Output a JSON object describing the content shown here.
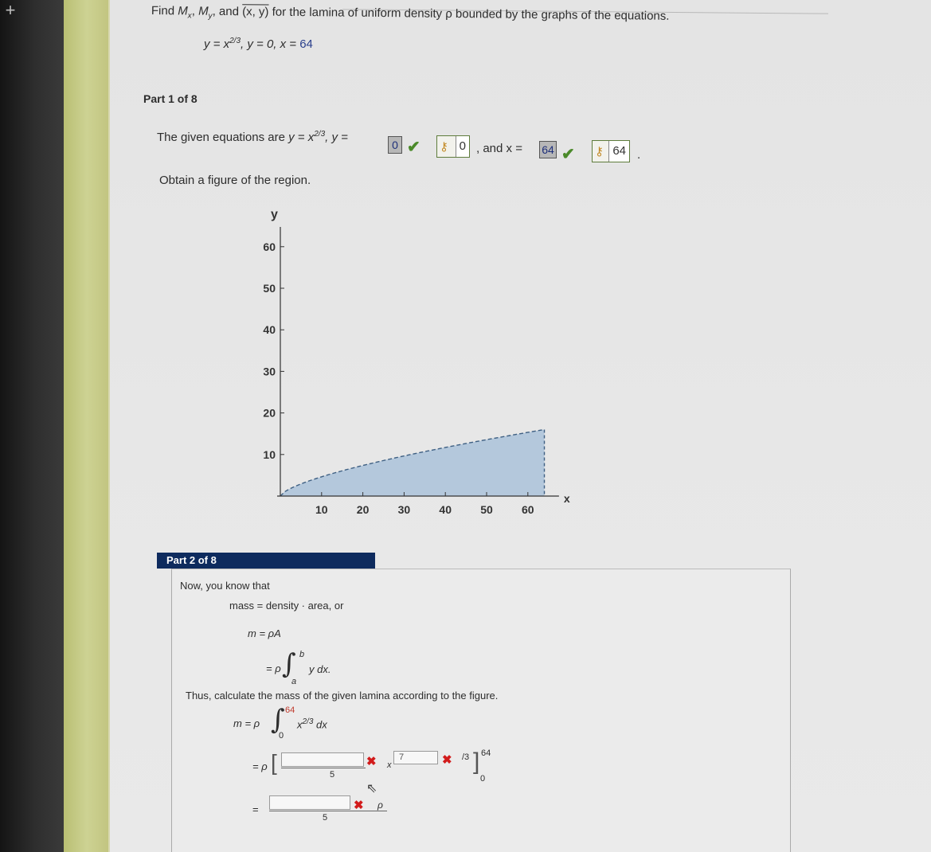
{
  "problem": {
    "find": "Find",
    "mx": "M",
    "mx_sub": "x",
    "my": "M",
    "my_sub": "y",
    "and": "and",
    "xbar_ybar": "(x, y)",
    "rest": "for the lamina of uniform density ρ bounded by the graphs of the equations.",
    "eq_a": "y = x",
    "eq_exp": "2/3",
    "eq_b": ", y = 0, x = ",
    "eq_c": "64"
  },
  "part1": {
    "label": "Part 1 of 8",
    "given_prefix": "The given equations are",
    "given_a": "y = x",
    "given_exp": "2/3",
    "given_b": ", y =",
    "y_answer": "0",
    "y_key_value": "0",
    "and_x": ", and x =",
    "x_answer": "64",
    "x_key_value": "64",
    "period": ".",
    "instruction": "Obtain a figure of the region."
  },
  "chart_data": {
    "type": "area",
    "title": "",
    "xlabel": "x",
    "ylabel": "y",
    "function": "y = x^(2/3)",
    "x_range": [
      0,
      64
    ],
    "xlim": [
      0,
      66
    ],
    "ylim": [
      0,
      62
    ],
    "x_ticks": [
      10,
      20,
      30,
      40,
      50,
      60
    ],
    "y_ticks": [
      10,
      20,
      30,
      40,
      50,
      60
    ],
    "x": [
      0,
      8,
      16,
      24,
      32,
      40,
      48,
      56,
      64
    ],
    "y": [
      0,
      4,
      6.35,
      8.32,
      10.08,
      11.7,
      13.21,
      14.64,
      16
    ],
    "grid": false,
    "fill_color": "#b4c8dc",
    "boundary_style": "dashed"
  },
  "part2": {
    "label": "Part 2 of 8",
    "intro": "Now, you know that",
    "mass_line": "mass = density · area, or",
    "m_eq": "m = ρA",
    "integral_eq": "= ρ",
    "integral_upper": "b",
    "integral_lower": "a",
    "integrand": "y dx.",
    "instruction": "Thus, calculate the mass of the given lamina according to the figure.",
    "m_line_prefix": "m = ρ",
    "m_upper": "64",
    "m_lower": "0",
    "m_integrand_base": "x",
    "m_integrand_exp": "2/3",
    "m_integrand_dx": "dx",
    "step1_prefix": "= ρ",
    "step1_denominator": "5",
    "step1_x": "x",
    "step1_exp_value": "7",
    "step1_exp_tail": "/3",
    "step1_upper": "64",
    "step1_lower": "0",
    "step2_prefix": "=",
    "step2_denominator": "5",
    "step2_rho": "ρ"
  },
  "colors": {
    "header_bg": "#0e2b5e",
    "check": "#4b8a2a",
    "cross": "#d21b1b",
    "accent_green": "#c1c47f"
  }
}
